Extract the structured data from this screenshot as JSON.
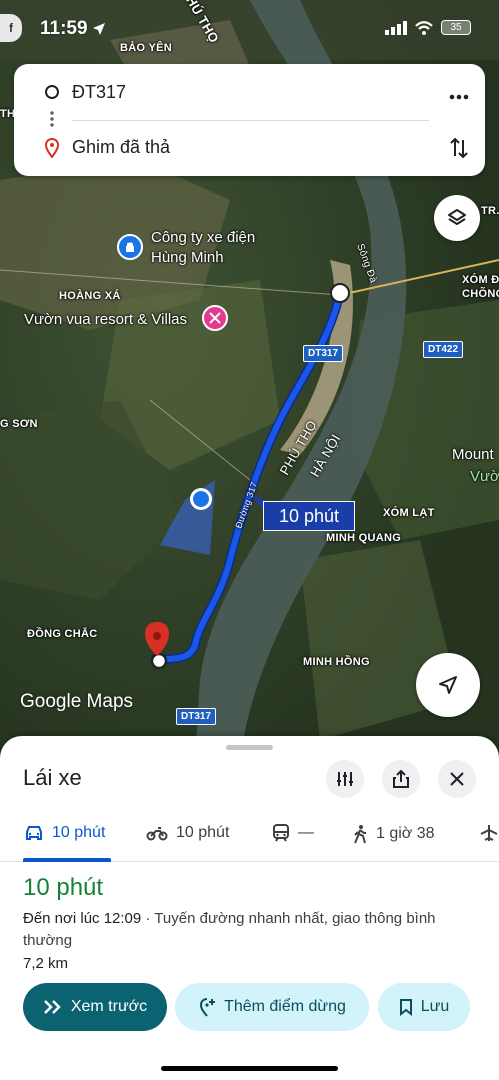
{
  "status_bar": {
    "time": "11:59",
    "app_badge": "f",
    "battery": "35"
  },
  "route_card": {
    "origin": "ĐT317",
    "destination": "Ghim đã thả",
    "more_icon": "more-vert-icon",
    "swap_icon": "swap-vertical-icon"
  },
  "map": {
    "labels": {
      "bao_yen": "BẢO YÊN",
      "phu_tho_top": "PHÚ THỌ",
      "th": "TH",
      "tra": "TR.",
      "cong_ty": "Công ty xe điện",
      "hung_minh": "Hùng Minh",
      "hoang_xa": "HOÀNG XÁ",
      "vuon_vua": "Vườn vua resort & Villas",
      "song_da": "Sông Đà",
      "xom_de": "XÓM ĐỀ",
      "chong": "CHÕNG",
      "g_son": "G SƠN",
      "phu_tho": "PHÚ THỌ",
      "ha_noi": "HÀ NỘI",
      "mount": "Mount",
      "vuon": "Vườ",
      "xom_lat": "XÓM LẠT",
      "minh_quang": "MINH QUANG",
      "dong_chac": "ĐỒNG CHẮC",
      "minh_hong": "MINH HỒNG",
      "road_name": "Đường 317",
      "dt317_a": "DT317",
      "dt422": "DT422",
      "dt317_b": "DT317"
    },
    "route_duration": "10 phút",
    "branding": "Google Maps"
  },
  "sheet": {
    "title": "Lái xe",
    "modes": [
      {
        "icon": "car-icon",
        "label": "10 phút"
      },
      {
        "icon": "motorcycle-icon",
        "label": "10 phút"
      },
      {
        "icon": "transit-icon",
        "label": "—"
      },
      {
        "icon": "walk-icon",
        "label": "1 giờ 38"
      }
    ],
    "result": {
      "time": "10 phút",
      "arrival": "Đến nơi lúc 12:09",
      "description": " · Tuyến đường nhanh nhất, giao thông bình thường",
      "distance": "7,2 km"
    },
    "actions": {
      "preview": "Xem trước",
      "add_stop": "Thêm điểm dừng",
      "save": "Lưu"
    }
  },
  "colors": {
    "route": "#1a56e8",
    "accent": "#0b57d0",
    "time_green": "#188038",
    "primary_button": "#0b6270"
  }
}
